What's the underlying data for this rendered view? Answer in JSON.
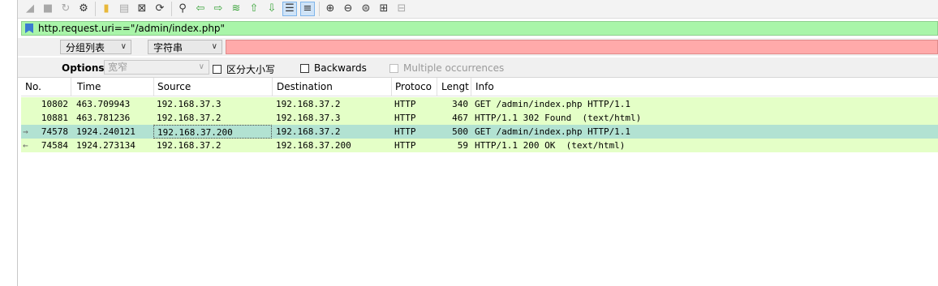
{
  "toolbar": {
    "icons": [
      "fin-icon",
      "stop-icon",
      "restart-icon",
      "options-icon",
      "open-file-icon",
      "save-icon",
      "close-file-icon",
      "reload-icon",
      "find-icon",
      "back-icon",
      "forward-icon",
      "goto-icon",
      "first-icon",
      "last-icon",
      "autoscroll-icon",
      "colorize-icon",
      "zoom-in-icon",
      "zoom-out-icon",
      "zoom-reset-icon",
      "resize-columns-icon",
      "layout-icon"
    ]
  },
  "filter": {
    "text": "http.request.uri==\"/admin/index.php\""
  },
  "find": {
    "scope_value": "分组列表",
    "type_value": "字符串",
    "search_value": ""
  },
  "options": {
    "label": "Options:",
    "charset_value": "宽窄",
    "case_label": "区分大小写",
    "backwards_label": "Backwards",
    "multiple_label": "Multiple occurrences"
  },
  "columns": [
    "No.",
    "Time",
    "Source",
    "Destination",
    "Protoco",
    "Lengt",
    "Info"
  ],
  "packets": [
    {
      "no": "10802",
      "time": "463.709943",
      "src": "192.168.37.3",
      "dst": "192.168.37.2",
      "proto": "HTTP",
      "len": "340",
      "info": "GET /admin/index.php HTTP/1.1",
      "marker": ""
    },
    {
      "no": "10881",
      "time": "463.781236",
      "src": "192.168.37.2",
      "dst": "192.168.37.3",
      "proto": "HTTP",
      "len": "467",
      "info": "HTTP/1.1 302 Found  (text/html)",
      "marker": ""
    },
    {
      "no": "74578",
      "time": "1924.240121",
      "src": "192.168.37.200",
      "dst": "192.168.37.2",
      "proto": "HTTP",
      "len": "500",
      "info": "GET /admin/index.php HTTP/1.1",
      "marker": "→"
    },
    {
      "no": "74584",
      "time": "1924.273134",
      "src": "192.168.37.2",
      "dst": "192.168.37.200",
      "proto": "HTTP",
      "len": "59",
      "info": "HTTP/1.1 200 OK  (text/html)",
      "marker": "←"
    }
  ],
  "colors": {
    "row_bg": "#e4ffc7",
    "selected_bg": "#b2e2d2",
    "filter_valid": "#a9f5a9",
    "find_invalid": "#ffaaaa"
  }
}
